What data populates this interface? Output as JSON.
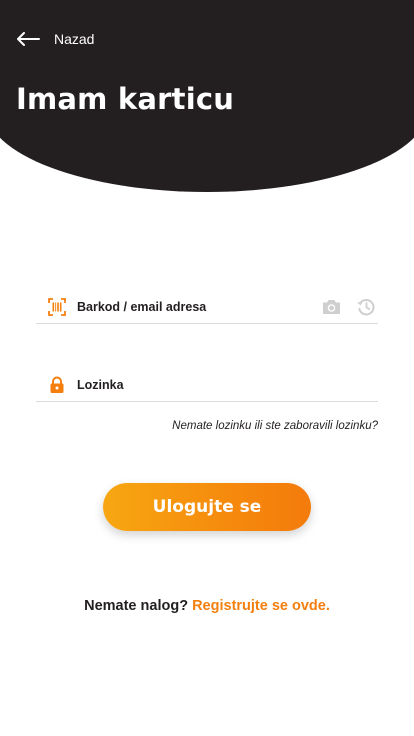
{
  "header": {
    "back_label": "Nazad",
    "title": "Imam karticu"
  },
  "form": {
    "barcode_label": "Barkod / email adresa",
    "password_label": "Lozinka",
    "forgot_link": "Nemate lozinku ili ste zaboravili lozinku?",
    "login_button": "Ulogujte se"
  },
  "footer": {
    "question": "Nemate nalog?",
    "register_link": "Registrujte se ovde."
  },
  "colors": {
    "header_bg": "#231f20",
    "accent": "#f47f0f",
    "accent_light": "#f7a712"
  },
  "icons": {
    "back": "arrow-left-icon",
    "barcode": "barcode-scan-icon",
    "camera": "camera-icon",
    "history": "history-icon",
    "lock": "lock-icon"
  }
}
